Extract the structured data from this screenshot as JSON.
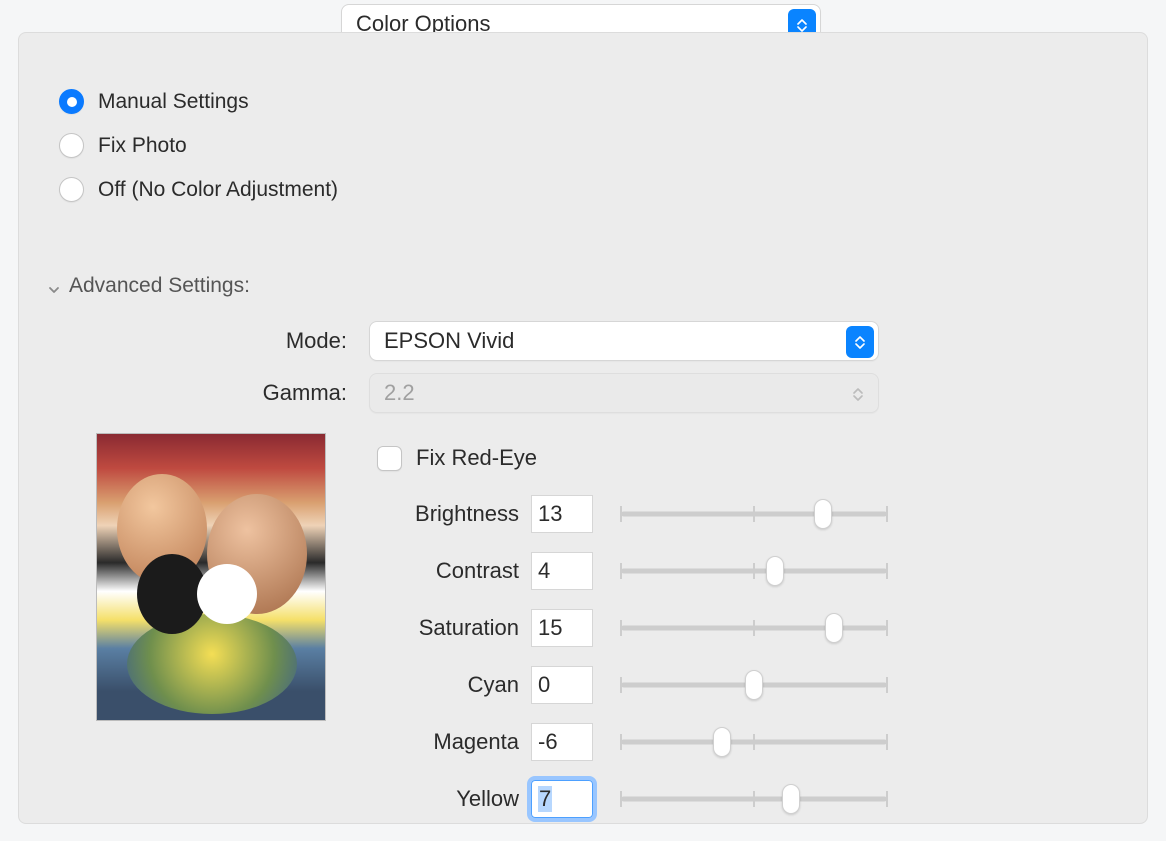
{
  "header": {
    "section_select": "Color Options"
  },
  "radios": {
    "manual": "Manual Settings",
    "fixphoto": "Fix Photo",
    "off": "Off (No Color Adjustment)",
    "selected": "manual"
  },
  "advanced": {
    "title": "Advanced Settings:",
    "mode_label": "Mode:",
    "mode_value": "EPSON Vivid",
    "gamma_label": "Gamma:",
    "gamma_value": "2.2",
    "fix_red_eye_label": "Fix Red-Eye",
    "fix_red_eye_checked": false
  },
  "sliders": [
    {
      "label": "Brightness",
      "value": "13",
      "pos": 0.76
    },
    {
      "label": "Contrast",
      "value": "4",
      "pos": 0.58
    },
    {
      "label": "Saturation",
      "value": "15",
      "pos": 0.8
    },
    {
      "label": "Cyan",
      "value": "0",
      "pos": 0.5
    },
    {
      "label": "Magenta",
      "value": "-6",
      "pos": 0.38
    },
    {
      "label": "Yellow",
      "value": "7",
      "pos": 0.64,
      "focused": true
    }
  ],
  "slider_range": {
    "min": -25,
    "max": 25
  }
}
